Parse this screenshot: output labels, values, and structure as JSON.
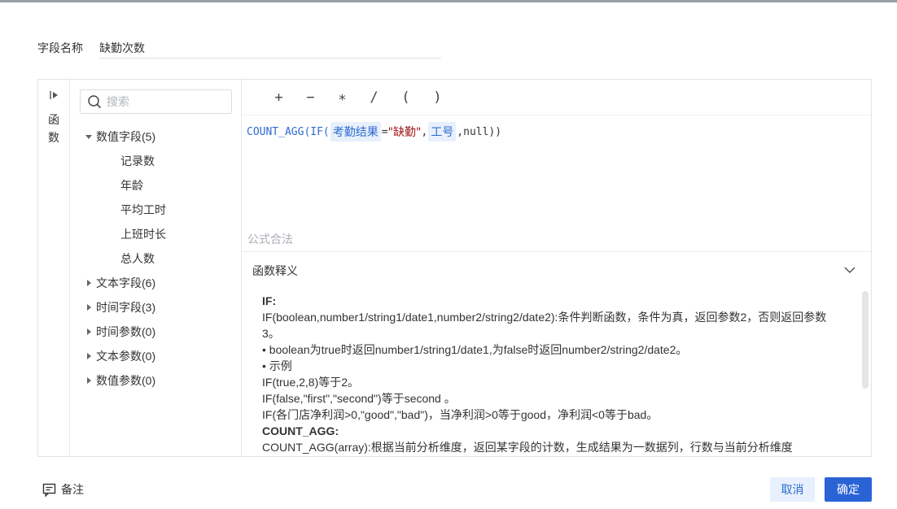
{
  "field": {
    "label": "字段名称",
    "value": "缺勤次数"
  },
  "function_tab": {
    "label": "函数",
    "icon": "expand-right-icon"
  },
  "search": {
    "placeholder": "搜索",
    "icon": "search-icon"
  },
  "tree": {
    "groups": [
      {
        "label": "数值字段(5)",
        "expanded": true,
        "children": [
          "记录数",
          "年龄",
          "平均工时",
          "上班时长",
          "总人数"
        ]
      },
      {
        "label": "文本字段(6)",
        "expanded": false
      },
      {
        "label": "时间字段(3)",
        "expanded": false
      },
      {
        "label": "时间参数(0)",
        "expanded": false
      },
      {
        "label": "文本参数(0)",
        "expanded": false
      },
      {
        "label": "数值参数(0)",
        "expanded": false
      }
    ]
  },
  "operators": [
    "+",
    "−",
    "∗",
    "/",
    "(",
    ")"
  ],
  "formula": {
    "func_open": "COUNT_AGG(IF(",
    "field1": "考勤结果",
    "eq": "=",
    "str_val": "\"缺勤\"",
    "comma1": ",",
    "field2": "工号",
    "tail": ",null))"
  },
  "validation": "公式合法",
  "explain": {
    "title": "函数释义",
    "lines": [
      {
        "text": "IF:",
        "bold": true
      },
      {
        "text": "IF(boolean,number1/string1/date1,number2/string2/date2):条件判断函数，条件为真，返回参数2，否则返回参数3。",
        "bold": false
      },
      {
        "text": "• boolean为true时返回number1/string1/date1,为false时返回number2/string2/date2。",
        "bold": false
      },
      {
        "text": "• 示例",
        "bold": false
      },
      {
        "text": "IF(true,2,8)等于2。",
        "bold": false
      },
      {
        "text": "IF(false,\"first\",\"second\")等于second 。",
        "bold": false
      },
      {
        "text": "IF(各门店净利润>0,\"good\",\"bad\")，当净利润>0等于good，净利润<0等于bad。",
        "bold": false
      },
      {
        "text": "COUNT_AGG:",
        "bold": true
      },
      {
        "text": "COUNT_AGG(array):根据当前分析维度，返回某字段的计数，生成结果为一数据列，行数与当前分析维度",
        "bold": false
      }
    ]
  },
  "footer": {
    "note_label": "备注",
    "cancel_label": "取消",
    "ok_label": "确定"
  },
  "colors": {
    "primary": "#2a63d6",
    "chip_bg": "#e8f0fc",
    "string": "#a31515"
  }
}
